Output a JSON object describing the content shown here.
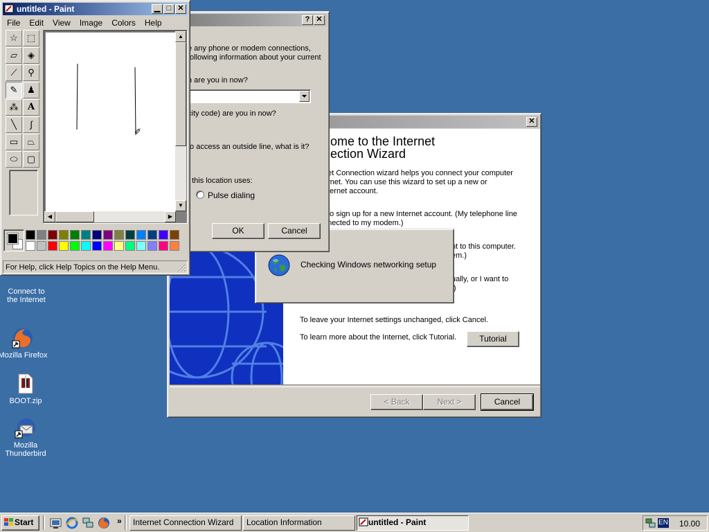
{
  "desktop": {
    "icons": [
      {
        "label_line1": "Connect to",
        "label_line2": "the Internet"
      },
      {
        "label_line1": "Mozilla Firefox",
        "label_line2": ""
      },
      {
        "label_line1": "BOOT.zip",
        "label_line2": ""
      },
      {
        "label_line1": "Mozilla",
        "label_line2": "Thunderbird"
      }
    ]
  },
  "paint": {
    "title": "untitled - Paint",
    "menu": [
      "File",
      "Edit",
      "View",
      "Image",
      "Colors",
      "Help"
    ],
    "status": "For Help, click Help Topics on the Help Menu.",
    "palette_top": [
      "#000000",
      "#808080",
      "#800000",
      "#808000",
      "#008000",
      "#008080",
      "#000080",
      "#800080",
      "#808040",
      "#004040",
      "#0080ff",
      "#004080",
      "#4000ff",
      "#804000"
    ],
    "palette_bottom": [
      "#ffffff",
      "#c0c0c0",
      "#ff0000",
      "#ffff00",
      "#00ff00",
      "#00ffff",
      "#0000ff",
      "#ff00ff",
      "#ffff80",
      "#00ff80",
      "#80ffff",
      "#8080ff",
      "#ff0080",
      "#ff8040"
    ],
    "fg_color": "#000000",
    "bg_color": "#ffffff"
  },
  "location": {
    "help_btn": "?",
    "close_btn": "✕",
    "intro_line1": "e any phone or modem connections,",
    "intro_line2": "following information about your current",
    "q_country": "h are you in now?",
    "q_area": "city code) are you in now?",
    "q_outside": "to access an outside line, what is it?",
    "q_dialing": "t this location uses:",
    "pulse_label": "Pulse dialing",
    "ok": "OK",
    "cancel": "Cancel"
  },
  "wizard": {
    "heading_line1": "ome to the Internet",
    "heading_line2": "ection Wizard",
    "intro_line1": "net Connection wizard helps you connect your computer",
    "intro_line2": "ernet.  You can use this wizard to set up a new or",
    "intro_line3": "nternet account.",
    "opt1_line1": "t to sign up for a new Internet account. (My telephone line",
    "opt1_line2": "nnected to my modem.)",
    "opt2_line1": "nt to this computer.",
    "opt2_line2": "em.)",
    "opt3_line1": "ually, or I want to",
    "opt3_line2": ".)",
    "leave_text": "To leave your Internet settings unchanged, click Cancel.",
    "learn_text": "To learn more about the Internet, click Tutorial.",
    "tutorial": "Tutorial",
    "back": "< Back",
    "next": "Next >",
    "cancel": "Cancel"
  },
  "progress": {
    "text": "Checking Windows networking setup"
  },
  "taskbar": {
    "start": "Start",
    "chevron": "»",
    "tasks": [
      "Internet Connection Wizard",
      "Location Information",
      "untitled - Paint"
    ],
    "lang": "EN",
    "clock": "10.00"
  }
}
